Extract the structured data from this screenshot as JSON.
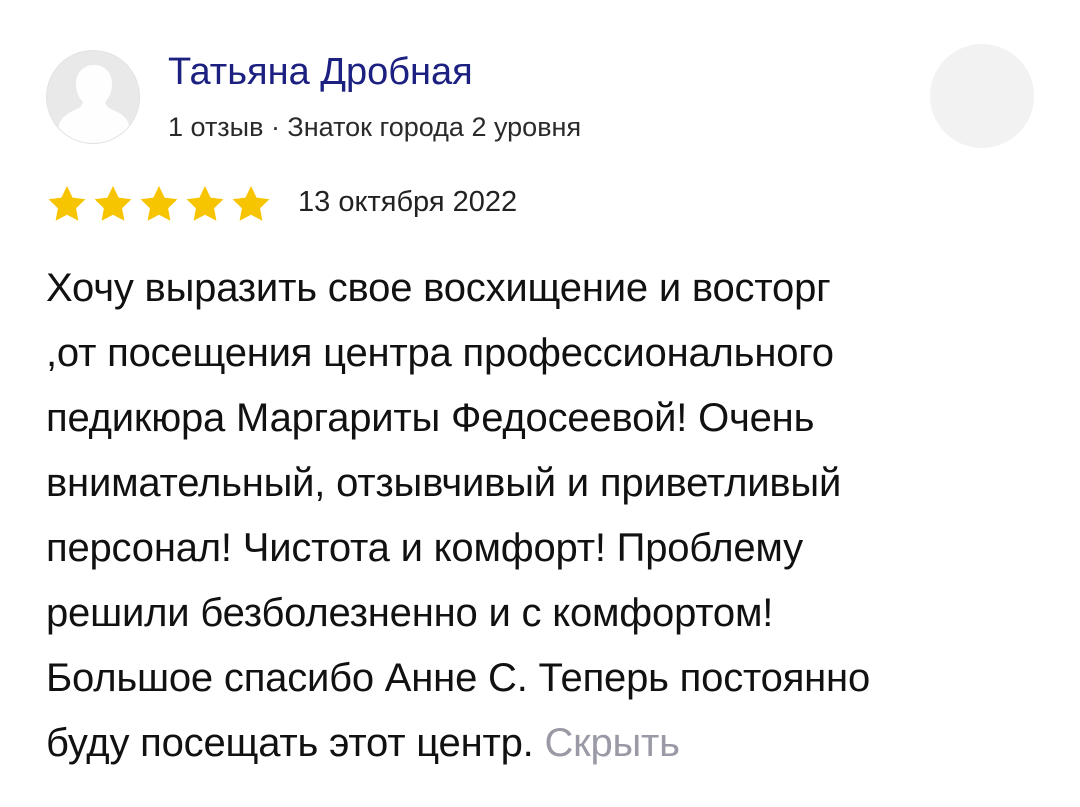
{
  "author": {
    "name": "Татьяна Дробная",
    "meta": "1 отзыв · Знаток города 2 уровня",
    "avatar_icon": "person-silhouette-icon"
  },
  "subscribe": {
    "icon": "add-user-icon"
  },
  "rating": {
    "value": 5,
    "max": 5,
    "star_color": "#f7c400"
  },
  "date": "13 октября 2022",
  "review": {
    "lines": [
      "Хочу выразить свое восхищение и восторг",
      ",от посещения центра профессионального",
      "педикюра Маргариты Федосеевой! Очень",
      "внимательный, отзывчивый и приветливый",
      "персонал! Чистота и комфорт! Проблему",
      "решили безболезненно и с комфортом!",
      "Большое спасибо Анне С. Теперь постоянно",
      "буду посещать этот центр."
    ],
    "hide_label": "Скрыть"
  },
  "colors": {
    "author_name": "#1c2080",
    "hide_link": "#9a9aa6"
  }
}
